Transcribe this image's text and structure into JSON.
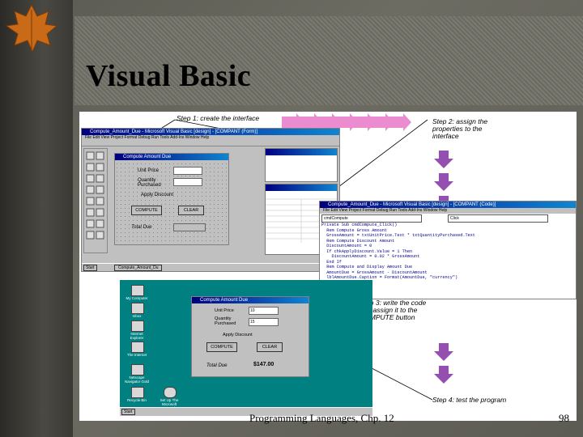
{
  "slide": {
    "title": "Visual Basic",
    "footer": "Programming Languages, Chp. 12",
    "page_number": "98"
  },
  "steps": {
    "step1": "Step 1: create the interface",
    "step2": "Step 2: assign the properties to the interface",
    "step3": "Step 3: write the code and assign it to the COMPUTE button",
    "step4": "Step 4: test the program"
  },
  "vb_ide": {
    "title": "Compute_Amount_Due - Microsoft Visual Basic [design] - [COMPANT (Form)]",
    "menu": "File  Edit  View  Project  Format  Debug  Run  Tools  Add-Ins  Window  Help",
    "form_title": "Compute Amount Due",
    "unit_price_label": "Unit Price",
    "quantity_label": "Quantity Purchased",
    "discount_label": "Apply Discount",
    "compute_label": "COMPUTE",
    "clear_label": "CLEAR",
    "total_label": "Total Due",
    "taskbar_start": "Start",
    "taskbar_item": "Compute_Amount_Du"
  },
  "code_window": {
    "title": "Compute_Amount_Due - Microsoft Visual Basic [design] - [COMPANT (Code)]",
    "object": "cmdCompute",
    "event": "Click",
    "lines": "Private Sub cmdCompute_Click()\n  Rem Compute Gross Amount\n  GrossAmount = txtUnitPrice.Text * txtQuantityPurchased.Text\n  Rem Compute Discount Amount\n  DiscountAmount = 0\n  If chkApplyDiscount.Value = 1 Then\n    DiscountAmount = 0.02 * GrossAmount\n  End If\n  Rem Compute and Display Amount Due\n  AmountDue = GrossAmount - DiscountAmount\n  lblAmountDue.Caption = Format(AmountDue, \"currency\")\nEnd Sub"
  },
  "run_window": {
    "title": "Compute Amount Due",
    "unit_price_label": "Unit Price",
    "unit_price_value": "10",
    "quantity_label": "Quantity Purchased",
    "quantity_value": "15",
    "discount_label": "Apply Discount",
    "compute_label": "COMPUTE",
    "clear_label": "CLEAR",
    "total_label": "Total Due",
    "total_value": "$147.00"
  },
  "desktop_icons": [
    "My Computer",
    "Inbox",
    "Internet Explorer",
    "The Internet",
    "Netscape Navigator Gold",
    "Recycle Bin",
    "Set Up The Microsoft Network"
  ],
  "colors": {
    "arrow_pink": "#e879c8",
    "arrow_purple": "#8a3ca8",
    "titlebar": "#000080",
    "desktop": "#008080"
  }
}
